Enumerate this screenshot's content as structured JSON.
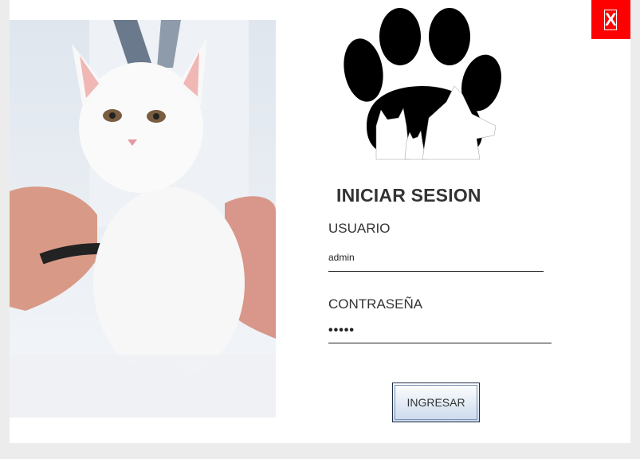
{
  "window": {
    "background": "#ffffff"
  },
  "close": {
    "label": "X",
    "color": "#ff0000"
  },
  "logo": {
    "icon": "paw-pet-silhouettes-icon"
  },
  "photo": {
    "subject": "kitten-vet-photo"
  },
  "login": {
    "title": "INICIAR SESION",
    "user_label": "USUARIO",
    "user_value": "admin",
    "pass_label": "CONTRASEÑA",
    "pass_value": "•••••",
    "submit_label": "INGRESAR"
  }
}
